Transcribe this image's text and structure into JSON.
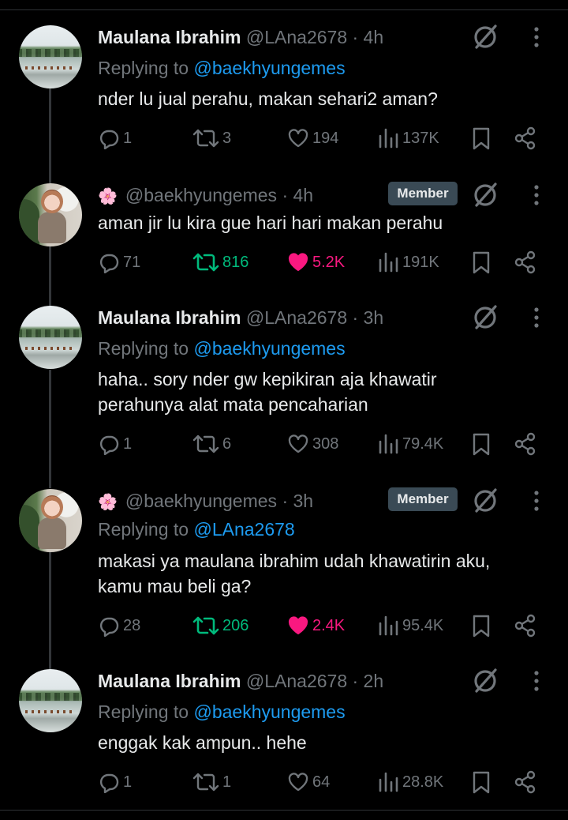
{
  "tweets": [
    {
      "name": "Maulana Ibrahim",
      "handle": "@LAna2678",
      "time": "· 4h",
      "replying_prefix": "Replying to ",
      "replying_to": "@baekhyungemes",
      "text": "nder lu jual perahu, makan sehari2 aman?",
      "replies": "1",
      "reposts": "3",
      "likes": "194",
      "views": "137K",
      "liked": false,
      "reposted": false
    },
    {
      "name": "",
      "handle": "@baekhyungemes",
      "time": "· 4h",
      "badge": "Member",
      "text": "aman jir lu kira gue hari hari makan perahu",
      "replies": "71",
      "reposts": "816",
      "likes": "5.2K",
      "views": "191K",
      "liked": true,
      "reposted": true
    },
    {
      "name": "Maulana Ibrahim",
      "handle": "@LAna2678",
      "time": "· 3h",
      "replying_prefix": "Replying to ",
      "replying_to": "@baekhyungemes",
      "text_line1": "haha.. sory nder gw kepikiran aja khawatir",
      "text_line2": "perahunya alat mata pencaharian",
      "replies": "1",
      "reposts": "6",
      "likes": "308",
      "views": "79.4K",
      "liked": false,
      "reposted": false
    },
    {
      "name": "",
      "handle": "@baekhyungemes",
      "time": "· 3h",
      "badge": "Member",
      "replying_prefix": "Replying to ",
      "replying_to": "@LAna2678",
      "text_line1": "makasi ya maulana ibrahim udah khawatirin aku,",
      "text_line2": "kamu mau beli ga?",
      "replies": "28",
      "reposts": "206",
      "likes": "2.4K",
      "views": "95.4K",
      "liked": true,
      "reposted": true
    },
    {
      "name": "Maulana Ibrahim",
      "handle": "@LAna2678",
      "time": "· 2h",
      "replying_prefix": "Replying to ",
      "replying_to": "@baekhyungemes",
      "text": "enggak kak ampun.. hehe",
      "replies": "1",
      "reposts": "1",
      "likes": "64",
      "views": "28.8K",
      "liked": false,
      "reposted": false
    }
  ],
  "colors": {
    "background": "#000000",
    "text": "#e7e9ea",
    "secondary": "#71767b",
    "mention": "#1d9bf0",
    "repost_active": "#00ba7c",
    "like_active": "#f91880",
    "badge_bg": "#3a4a55"
  },
  "icons": [
    "grok-icon",
    "more-icon",
    "reply-icon",
    "repost-icon",
    "like-icon",
    "views-icon",
    "bookmark-icon",
    "share-icon",
    "flower-emoji"
  ]
}
